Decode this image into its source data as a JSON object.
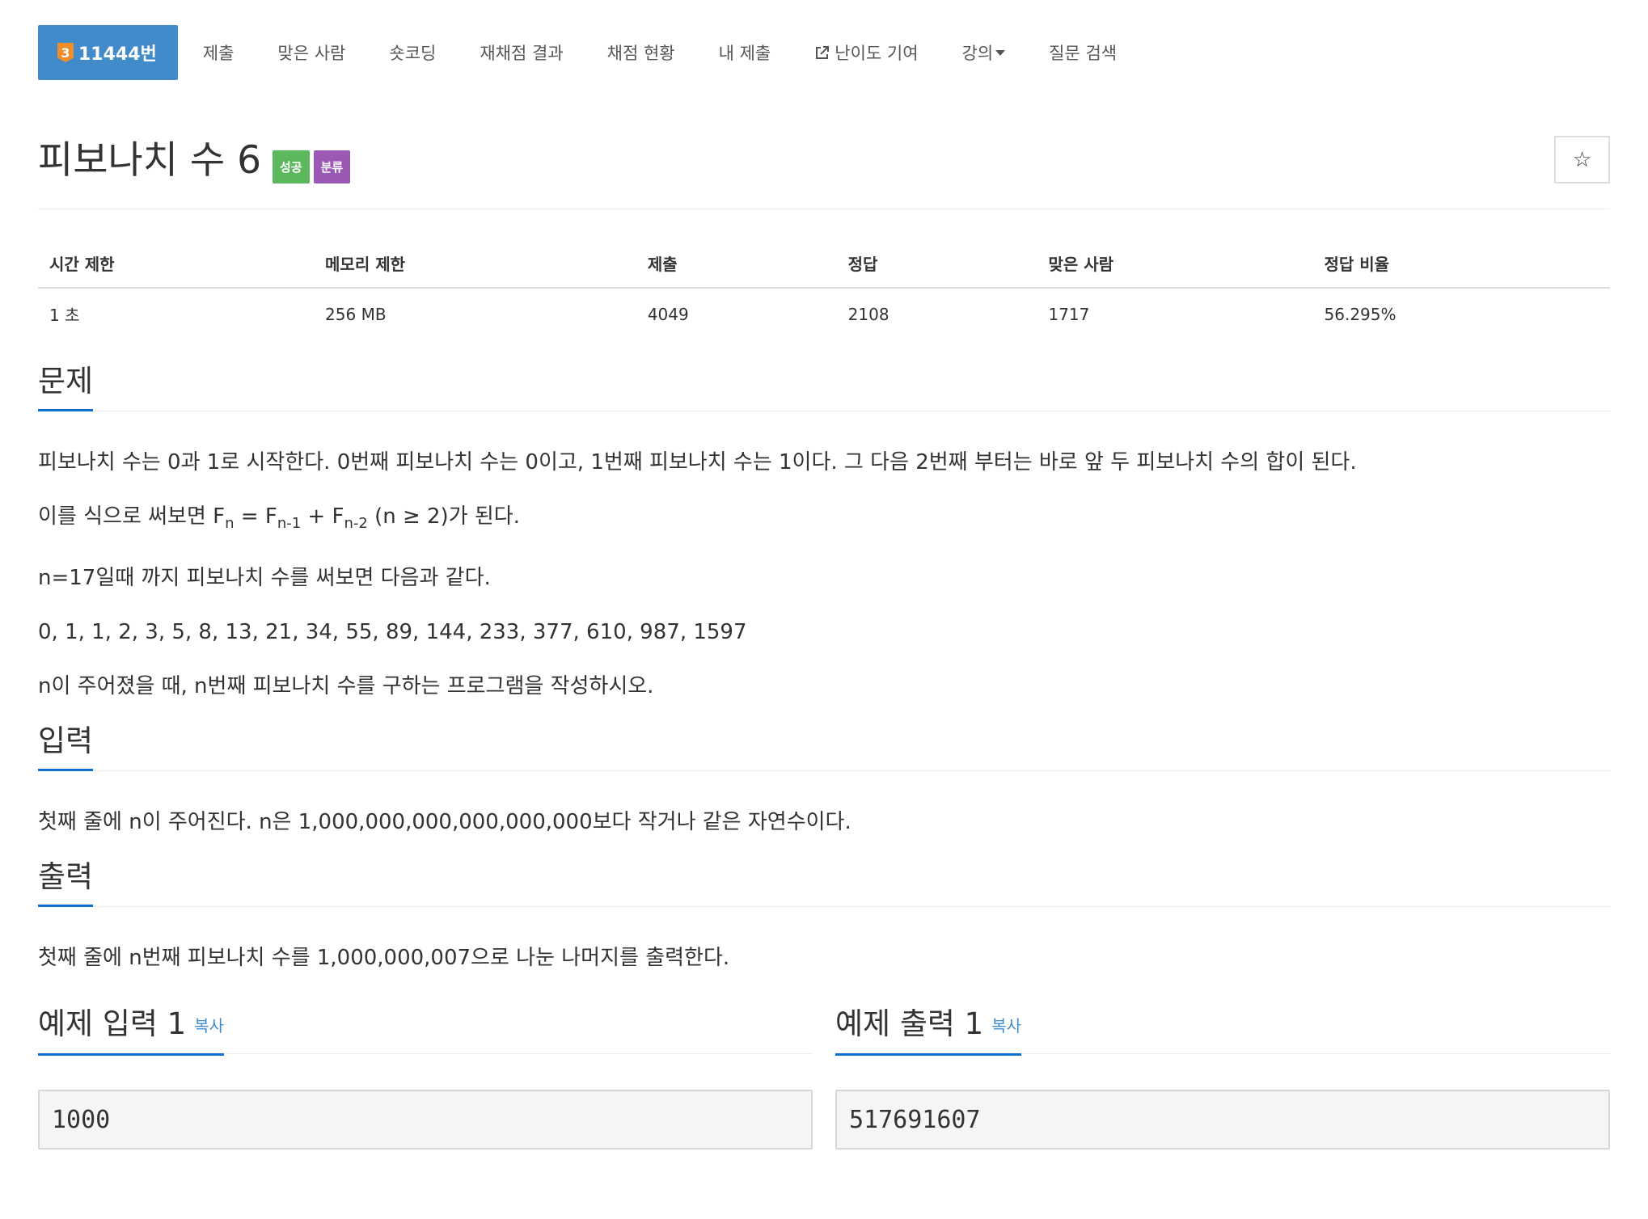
{
  "nav": {
    "active_tier": "3",
    "active_label": "11444번",
    "items": [
      "제출",
      "맞은 사람",
      "숏코딩",
      "재채점 결과",
      "채점 현황",
      "내 제출",
      "난이도 기여",
      "강의",
      "질문 검색"
    ]
  },
  "problem": {
    "title": "피보나치 수 6",
    "label_success": "성공",
    "label_category": "분류",
    "star_icon": "☆"
  },
  "stats": {
    "headers": [
      "시간 제한",
      "메모리 제한",
      "제출",
      "정답",
      "맞은 사람",
      "정답 비율"
    ],
    "values": [
      "1 초",
      "256 MB",
      "4049",
      "2108",
      "1717",
      "56.295%"
    ]
  },
  "sections": {
    "description_title": "문제",
    "description": {
      "p1": "피보나치 수는 0과 1로 시작한다. 0번째 피보나치 수는 0이고, 1번째 피보나치 수는 1이다. 그 다음 2번째 부터는 바로 앞 두 피보나치 수의 합이 된다.",
      "p2_pre": "이를 식으로 써보면 F",
      "p2_sub1": "n",
      "p2_mid1": " = F",
      "p2_sub2": "n-1",
      "p2_mid2": " + F",
      "p2_sub3": "n-2",
      "p2_post": " (n ≥ 2)가 된다.",
      "p3": "n=17일때 까지 피보나치 수를 써보면 다음과 같다.",
      "p4": "0, 1, 1, 2, 3, 5, 8, 13, 21, 34, 55, 89, 144, 233, 377, 610, 987, 1597",
      "p5": "n이 주어졌을 때, n번째 피보나치 수를 구하는 프로그램을 작성하시오."
    },
    "input_title": "입력",
    "input_text": "첫째 줄에 n이 주어진다. n은 1,000,000,000,000,000,000보다 작거나 같은 자연수이다.",
    "output_title": "출력",
    "output_text": "첫째 줄에 n번째 피보나치 수를 1,000,000,007으로 나눈 나머지를 출력한다."
  },
  "samples": {
    "input_title": "예제 입력 1",
    "output_title": "예제 출력 1",
    "copy_label": "복사",
    "input_value": "1000",
    "output_value": "517691607"
  }
}
